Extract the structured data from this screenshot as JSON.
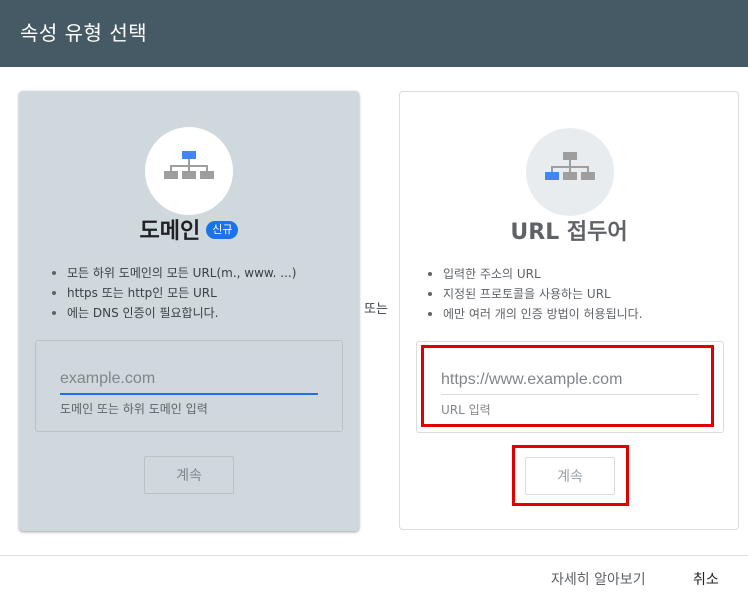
{
  "dialog": {
    "title": "속성 유형 선택"
  },
  "domain_card": {
    "title": "도메인",
    "badge": "신규",
    "bullets": [
      "모든 하위 도메인의 모든 URL(m., www. ...)",
      "https 또는 http인 모든 URL",
      "에는 DNS 인증이 필요합니다."
    ],
    "input_placeholder": "example.com",
    "input_value": "",
    "input_help": "도메인 또는 하위 도메인 입력",
    "continue_label": "계속",
    "colors": {
      "background": "#cfd8dc",
      "accent": "#1a73e8",
      "icon_highlight": "#4285f4",
      "icon_gray": "#9e9e9e"
    }
  },
  "separator": {
    "label": "또는"
  },
  "url_card": {
    "title": "URL 접두어",
    "bullets": [
      "입력한 주소의 URL",
      "지정된 프로토콜을 사용하는 URL",
      "에만 여러 개의 인증 방법이 허용됩니다."
    ],
    "input_placeholder": "https://www.example.com",
    "input_value": "",
    "input_help": "URL 입력",
    "continue_label": "계속",
    "colors": {
      "background": "#ffffff",
      "icon_highlight": "#4285f4",
      "icon_gray": "#9e9e9e"
    }
  },
  "annotations": {
    "highlight_color": "#e00000"
  },
  "footer": {
    "learn_more_label": "자세히 알아보기",
    "cancel_label": "취소"
  },
  "icons": {
    "domain": "sitemap-icon",
    "url_prefix": "sitemap-icon"
  }
}
